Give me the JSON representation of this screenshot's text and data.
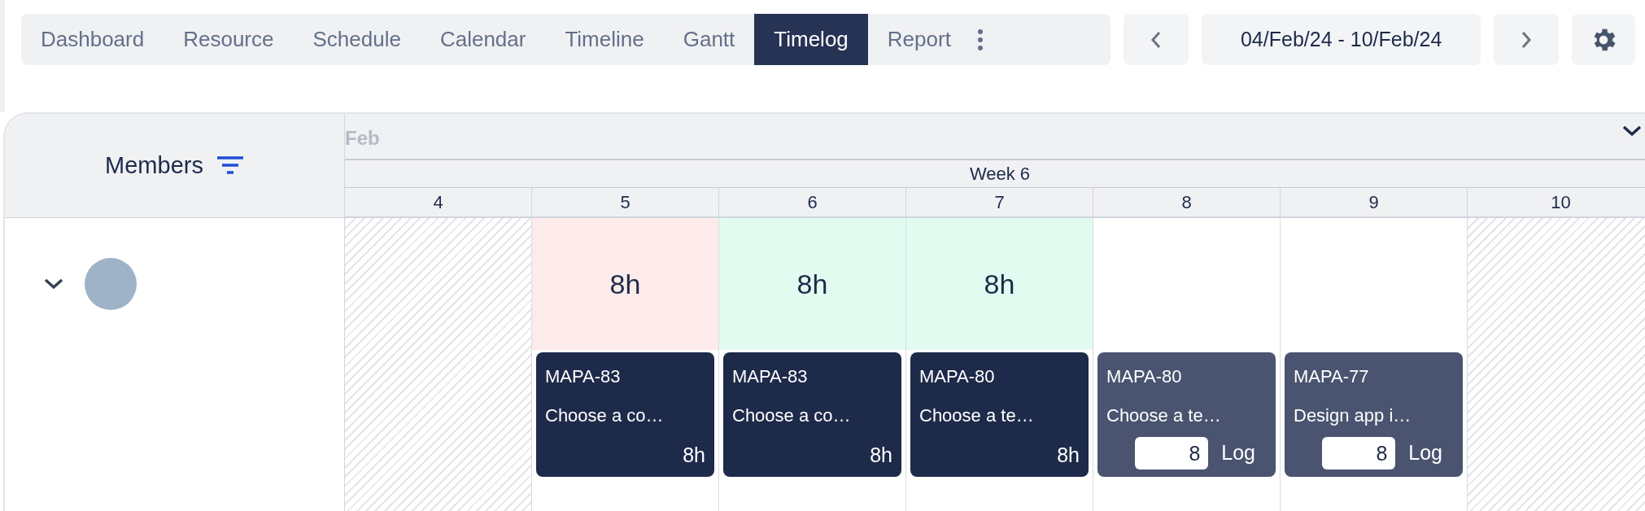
{
  "nav": {
    "tabs": [
      {
        "label": "Dashboard",
        "selected": false
      },
      {
        "label": "Resource",
        "selected": false
      },
      {
        "label": "Schedule",
        "selected": false
      },
      {
        "label": "Calendar",
        "selected": false
      },
      {
        "label": "Timeline",
        "selected": false
      },
      {
        "label": "Gantt",
        "selected": false
      },
      {
        "label": "Timelog",
        "selected": true
      },
      {
        "label": "Report",
        "selected": false
      }
    ],
    "date_range": "04/Feb/24 - 10/Feb/24"
  },
  "grid": {
    "members_header": "Members",
    "month": "Feb",
    "week": "Week 6",
    "days": [
      {
        "label": "4",
        "kind": "weekend"
      },
      {
        "label": "5",
        "kind": "workday",
        "total": "8h",
        "color": "#fcebea",
        "entry": {
          "kind": "logged",
          "key": "MAPA-83",
          "title": "Choose a co…",
          "hours": "8h"
        }
      },
      {
        "label": "6",
        "kind": "workday",
        "total": "8h",
        "color": "#e2fbf1",
        "entry": {
          "kind": "logged",
          "key": "MAPA-83",
          "title": "Choose a co…",
          "hours": "8h"
        }
      },
      {
        "label": "7",
        "kind": "workday",
        "total": "8h",
        "color": "#e2fbf1",
        "entry": {
          "kind": "logged",
          "key": "MAPA-80",
          "title": "Choose a te…",
          "hours": "8h"
        }
      },
      {
        "label": "8",
        "kind": "workday",
        "entry": {
          "kind": "pending",
          "key": "MAPA-80",
          "title": "Choose a te…",
          "value": "8",
          "action": "Log"
        }
      },
      {
        "label": "9",
        "kind": "workday",
        "entry": {
          "kind": "pending",
          "key": "MAPA-77",
          "title": "Design app i…",
          "value": "8",
          "action": "Log"
        }
      },
      {
        "label": "10",
        "kind": "weekend"
      }
    ],
    "member": {
      "expanded": true
    }
  }
}
